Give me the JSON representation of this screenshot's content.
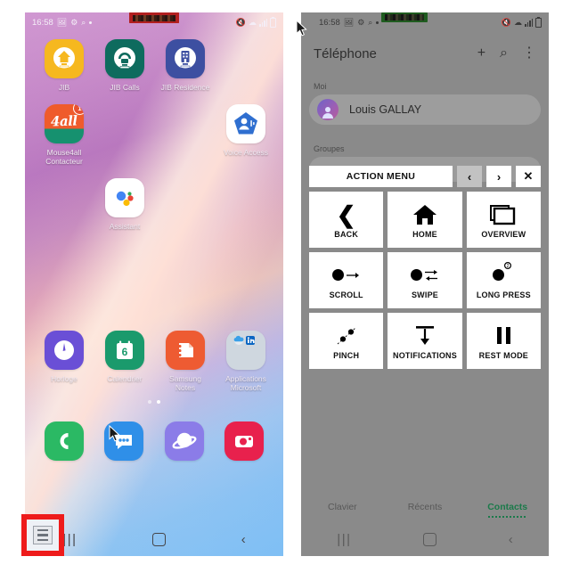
{
  "left_phone": {
    "status_bar": {
      "time": "16:58",
      "icons": [
        "gallery-icon",
        "gear-icon",
        "search-icon",
        "dot-icon"
      ],
      "right_icons": [
        "mute-icon",
        "wifi-icon",
        "signal-icon",
        "battery-icon"
      ]
    },
    "redaction_color": "#b21f1f",
    "apps": [
      [
        {
          "label": "JIB",
          "icon": "jib-icon",
          "color": "#f6b81f",
          "badge": null
        },
        {
          "label": "JIB Calls",
          "icon": "jib-calls-icon",
          "color": "#0e6b5e",
          "badge": null
        },
        {
          "label": "JIB Residence",
          "icon": "jib-residence-icon",
          "color": "#3d4fa1",
          "badge": null
        },
        {
          "label": "",
          "icon": "empty-slot",
          "color": "",
          "badge": null
        }
      ],
      [
        {
          "label": "Mouse4all\nContacteur",
          "icon": "mouse4all-icon",
          "color": "#ef5b2b",
          "badge": "1"
        },
        {
          "label": "",
          "icon": "empty-slot",
          "color": "",
          "badge": null
        },
        {
          "label": "",
          "icon": "empty-slot",
          "color": "",
          "badge": null
        },
        {
          "label": "Voice Access",
          "icon": "voice-access-icon",
          "color": "#ffffff",
          "badge": null
        }
      ],
      [
        {
          "label": "",
          "icon": "empty-slot",
          "color": "",
          "badge": null
        },
        {
          "label": "Assistant",
          "icon": "google-assistant-icon",
          "color": "#ffffff",
          "badge": null
        },
        {
          "label": "",
          "icon": "empty-slot",
          "color": "",
          "badge": null
        },
        {
          "label": "",
          "icon": "empty-slot",
          "color": "",
          "badge": null
        }
      ],
      [
        {
          "label": "Horloge",
          "icon": "clock-icon",
          "color": "#6a4fd6",
          "badge": null
        },
        {
          "label": "Calendrier",
          "icon": "calendar-icon",
          "color": "#1a9a6c",
          "badge": null
        },
        {
          "label": "Samsung\nNotes",
          "icon": "samsung-notes-icon",
          "color": "#ee5b32",
          "badge": null
        },
        {
          "label": "Applications\nMicrosoft",
          "icon": "microsoft-apps-folder-icon",
          "color": "#cfd7df",
          "badge": null
        }
      ]
    ],
    "calendar_day": "6",
    "page_dots": {
      "count": 2,
      "active_index": 1
    },
    "dock": [
      {
        "label": "phone-app",
        "icon": "phone-icon",
        "color": "#2bb964"
      },
      {
        "label": "messages-app",
        "icon": "messages-icon",
        "color": "#2f8fe8"
      },
      {
        "label": "internet-app",
        "icon": "internet-icon",
        "color": "#8b7ce8"
      },
      {
        "label": "camera-app",
        "icon": "camera-icon",
        "color": "#e8214d"
      }
    ],
    "nav_bar": {
      "recents": "recents-icon",
      "home": "home-icon",
      "back": "back-icon"
    },
    "highlight": {
      "name": "mouse4all-menu-button",
      "border_color": "#ee1b1b"
    }
  },
  "right_phone": {
    "status_bar": {
      "time": "16:58",
      "icons": [
        "gallery-icon",
        "gear-icon",
        "search-icon",
        "dot-icon"
      ],
      "right_icons": [
        "mute-icon",
        "wifi-icon",
        "signal-icon",
        "battery-icon"
      ]
    },
    "redaction_color": "#1f5c1f",
    "header": {
      "title": "Téléphone",
      "actions": [
        {
          "name": "add-contact-button",
          "glyph": "+"
        },
        {
          "name": "search-button",
          "glyph": "⌕"
        },
        {
          "name": "more-options-button",
          "glyph": "⋮"
        }
      ]
    },
    "sections": {
      "me_label": "Moi",
      "groups_label": "Groupes"
    },
    "me_contact": {
      "name": "Louis GALLAY",
      "avatar": "person-avatar-icon"
    },
    "action_menu": {
      "title": "ACTION MENU",
      "nav_buttons": [
        {
          "name": "prev-page-button",
          "glyph": "‹",
          "selected": true
        },
        {
          "name": "next-page-button",
          "glyph": "›",
          "selected": false
        },
        {
          "name": "close-menu-button",
          "glyph": "✕",
          "selected": false
        }
      ],
      "items": [
        {
          "label": "BACK",
          "icon": "back-chevron-icon"
        },
        {
          "label": "HOME",
          "icon": "home-icon"
        },
        {
          "label": "OVERVIEW",
          "icon": "overview-windows-icon"
        },
        {
          "label": "SCROLL",
          "icon": "scroll-dot-arrow-icon"
        },
        {
          "label": "SWIPE",
          "icon": "swipe-dot-arrows-icon"
        },
        {
          "label": "LONG PRESS",
          "icon": "long-press-dot-icon"
        },
        {
          "label": "PINCH",
          "icon": "pinch-two-dots-icon"
        },
        {
          "label": "NOTIFICATIONS",
          "icon": "notifications-down-arrow-icon"
        },
        {
          "label": "REST MODE",
          "icon": "pause-icon"
        }
      ]
    },
    "tabs": [
      {
        "label": "Clavier",
        "active": false
      },
      {
        "label": "Récents",
        "active": false
      },
      {
        "label": "Contacts",
        "active": true
      }
    ],
    "active_tab_color": "#1b7a4a",
    "nav_bar": {
      "recents": "recents-icon",
      "home": "home-icon",
      "back": "back-icon"
    }
  }
}
